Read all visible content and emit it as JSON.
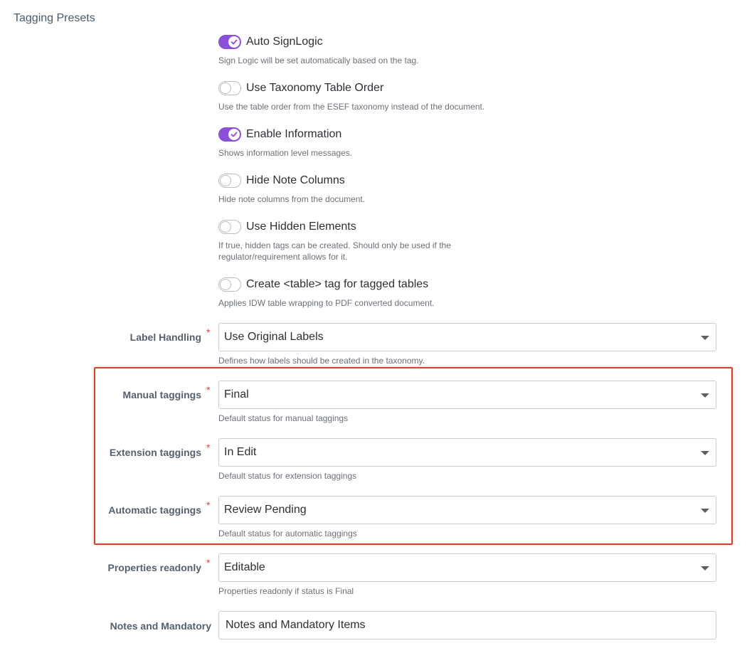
{
  "section": {
    "title": "Tagging Presets"
  },
  "toggles": [
    {
      "label": "Auto SignLogic",
      "on": true,
      "help": "Sign Logic will be set automatically based on the tag."
    },
    {
      "label": "Use Taxonomy Table Order",
      "on": false,
      "help": "Use the table order from the ESEF taxonomy instead of the document."
    },
    {
      "label": "Enable Information",
      "on": true,
      "help": "Shows information level messages."
    },
    {
      "label": "Hide Note Columns",
      "on": false,
      "help": "Hide note columns from the document."
    },
    {
      "label": "Use Hidden Elements",
      "on": false,
      "help_line1": "If true, hidden tags can be created. Should only be used if the",
      "help_line2": "regulator/requirement allows for it."
    },
    {
      "label": "Create <table> tag for tagged tables",
      "on": false,
      "help": "Applies IDW table wrapping to PDF converted document."
    }
  ],
  "fields": {
    "label_handling": {
      "label": "Label Handling",
      "required": "*",
      "value": "Use Original Labels",
      "help": "Defines how labels should be created in the taxonomy."
    },
    "manual_taggings": {
      "label": "Manual taggings",
      "required": "*",
      "value": "Final",
      "help": "Default status for manual taggings"
    },
    "extension_taggings": {
      "label": "Extension taggings",
      "required": "*",
      "value": "In Edit",
      "help": "Default status for extension taggings"
    },
    "automatic_taggings": {
      "label": "Automatic taggings",
      "required": "*",
      "value": "Review Pending",
      "help": "Default status for automatic taggings"
    },
    "properties_readonly": {
      "label": "Properties readonly",
      "required": "*",
      "value": "Editable",
      "help": "Properties readonly if status is Final"
    },
    "notes_mandatory": {
      "label": "Notes and Mandatory",
      "value": "Notes and Mandatory Items"
    }
  },
  "colors": {
    "accent": "#8c4fd8",
    "required": "#d64541",
    "highlight": "#d0452e"
  }
}
